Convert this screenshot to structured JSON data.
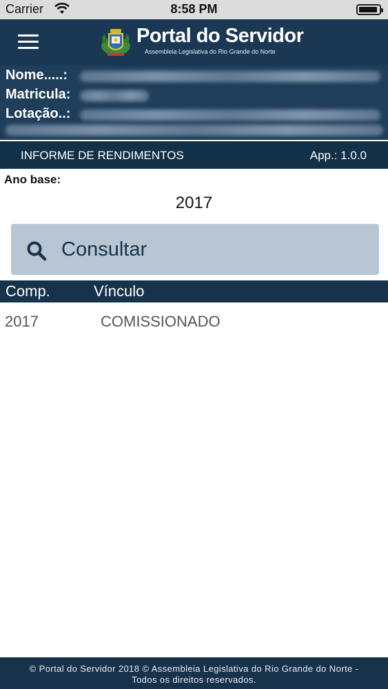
{
  "status_bar": {
    "carrier": "Carrier",
    "time": "8:58 PM"
  },
  "header": {
    "title": "Portal do Servidor",
    "subtitle": "Assembleia Legislativa do Rio Grande do Norte"
  },
  "user_info": {
    "name_label": "Nome.....:",
    "matricula_label": "Matricula:",
    "lotacao_label": "Lotação..:"
  },
  "section": {
    "title": "INFORME DE RENDIMENTOS",
    "version": "App.: 1.0.0"
  },
  "form": {
    "ano_base_label": "Ano base:",
    "ano_base_value": "2017",
    "consultar_label": "Consultar"
  },
  "table": {
    "headers": [
      "Comp.",
      "Vínculo"
    ],
    "rows": [
      [
        "2017",
        "COMISSIONADO"
      ]
    ]
  },
  "footer": {
    "line1": "© Portal do Servidor 2018 © Assembleia Legislativa do Rio Grande do Norte -",
    "line2": "Todos os direitos reservados."
  },
  "colors": {
    "header_bg": "#1a3854",
    "info_bg": "#1f3e5b",
    "section_bg": "#123048",
    "button_bg": "#b8c6d4",
    "footer_bg": "#17324b"
  }
}
